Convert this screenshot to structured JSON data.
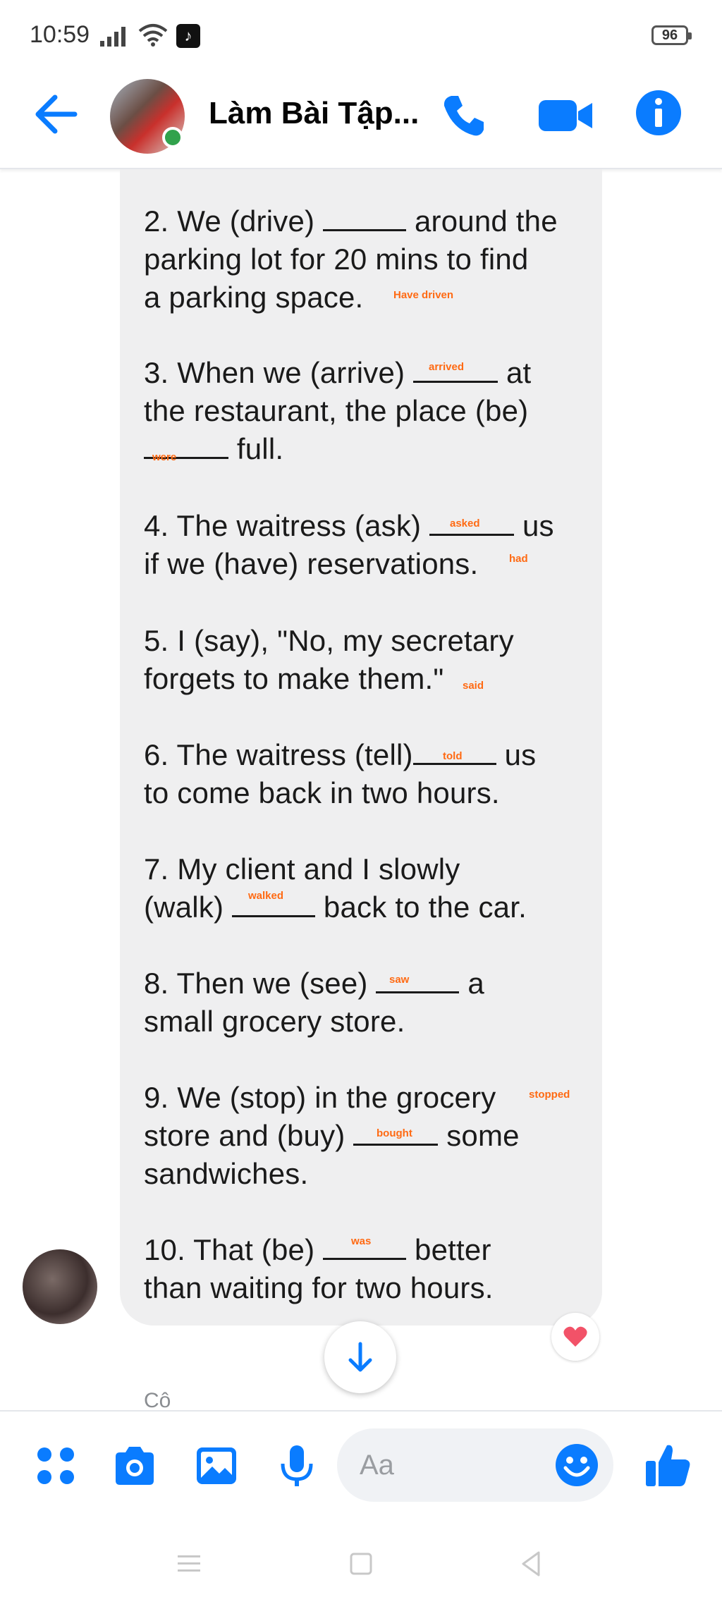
{
  "status_bar": {
    "time": "10:59",
    "battery": "96"
  },
  "header": {
    "title": "Làm Bài Tập..."
  },
  "colors": {
    "accent": "#0a7cff",
    "answer": "#ff6a13",
    "online": "#31a24c",
    "heart": "#f25268"
  },
  "exercises": [
    {
      "lines": [
        "2. We (drive) ",
        "parking lot for 20 mins to find",
        "a parking space."
      ],
      "after_blank": " around the",
      "answer": "Have driven"
    },
    {
      "lines": [
        "3. When we (arrive) ",
        "the restaurant, the place (be)",
        ""
      ],
      "after_blank": " at",
      "answer": "arrived",
      "line3_after": " full.",
      "answer2": "were"
    },
    {
      "lines": [
        "4. The waitress (ask) ",
        "if we (have) reservations."
      ],
      "after_blank": " us",
      "answer": "asked",
      "answer2": "had"
    },
    {
      "lines": [
        "5. I (say), \"No, my secretary",
        "forgets to make them.\""
      ],
      "answer": "said"
    },
    {
      "lines": [
        "6. The waitress (tell)",
        "to come back in two hours."
      ],
      "after_blank": " us",
      "answer": "told"
    },
    {
      "lines": [
        "7. My client and I slowly",
        "(walk) "
      ],
      "after_blank": " back to the car.",
      "answer": "walked"
    },
    {
      "lines": [
        "8. Then we (see) ",
        "small grocery store."
      ],
      "after_blank": " a",
      "answer": "saw"
    },
    {
      "lines": [
        "9. We (stop) in the grocery",
        "store and (buy) ",
        "sandwiches."
      ],
      "after_blank": " some",
      "answer": "stopped",
      "answer2": "bought"
    },
    {
      "lines": [
        "10. That (be) ",
        "than waiting for two hours."
      ],
      "after_blank": " better",
      "answer": "was"
    }
  ],
  "next_sender": "Cô",
  "composer": {
    "placeholder": "Aa"
  }
}
